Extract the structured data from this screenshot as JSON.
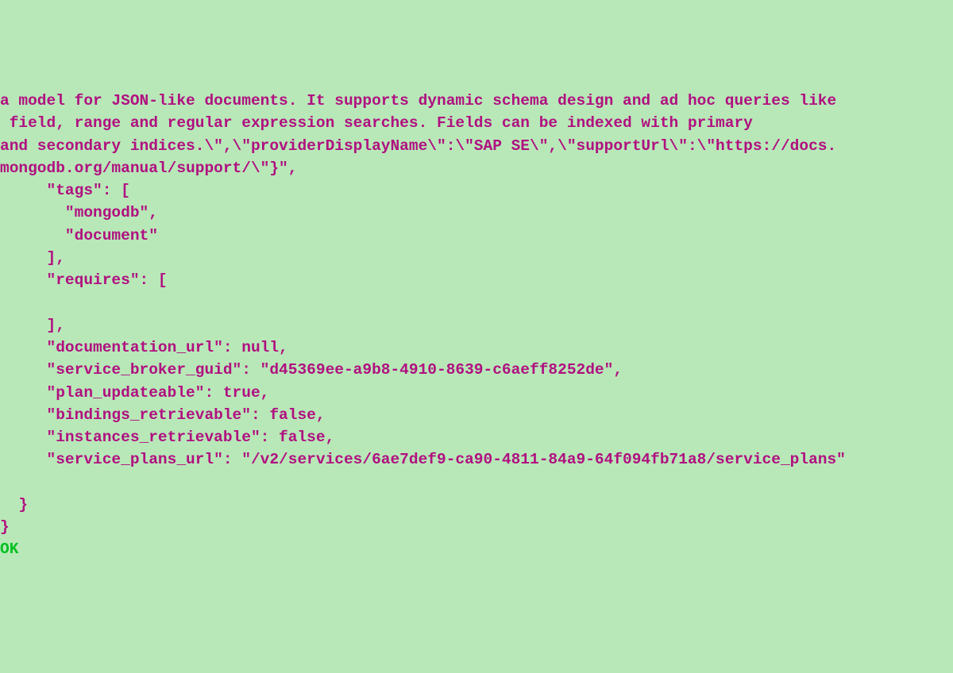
{
  "json_output": {
    "line1": "a model for JSON-like documents. It supports dynamic schema design and ad hoc queries like",
    "line2": " field, range and regular expression searches. Fields can be indexed with primary",
    "line3": "and secondary indices.\\\",\\\"providerDisplayName\\\":\\\"SAP SE\\\",\\\"supportUrl\\\":\\\"https://docs.",
    "line4": "mongodb.org/manual/support/\\\"}\",",
    "tags_label": "     \"tags\": [",
    "tag1": "       \"mongodb\",",
    "tag2": "       \"document\"",
    "tags_close": "     ],",
    "requires_label": "     \"requires\": [",
    "requires_blank": "",
    "requires_close": "     ],",
    "documentation_url": "     \"documentation_url\": null,",
    "service_broker_guid": "     \"service_broker_guid\": \"d45369ee-a9b8-4910-8639-c6aeff8252de\",",
    "plan_updateable": "     \"plan_updateable\": true,",
    "bindings_retrievable": "     \"bindings_retrievable\": false,",
    "instances_retrievable": "     \"instances_retrievable\": false,",
    "service_plans_url": "     \"service_plans_url\": \"/v2/services/6ae7def9-ca90-4811-84a9-64f094fb71a8/service_plans\"",
    "blank_after": "",
    "close_inner": "  }",
    "close_outer": "}"
  },
  "status": "OK"
}
